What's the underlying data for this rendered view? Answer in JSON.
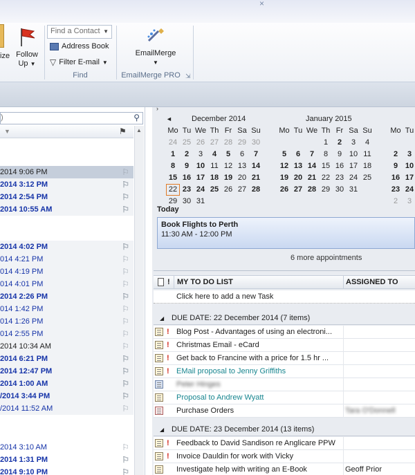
{
  "ribbon": {
    "follow_up_left_fragment": "ize",
    "follow_up_label": "Follow",
    "follow_up_label2": "Up",
    "find_contact_placeholder": "Find a Contact",
    "address_book_label": "Address Book",
    "filter_email_label": "Filter E-mail",
    "find_group_label": "Find",
    "emailmerge_label": "EmailMerge",
    "emailmerge_group_label": "EmailMerge PRO"
  },
  "mail_list": {
    "search_fragment": ")",
    "items": [
      {
        "text": "2014 9:06 PM",
        "style": "sel"
      },
      {
        "text": "2014 3:12 PM",
        "style": "bold"
      },
      {
        "text": "2014 2:54 PM",
        "style": "bold"
      },
      {
        "text": "2014 10:55 AM",
        "style": "bold"
      },
      {
        "text": "2014 4:02 PM",
        "style": "bold"
      },
      {
        "text": "014 4:21 PM",
        "style": "norm"
      },
      {
        "text": "014 4:19 PM",
        "style": "norm"
      },
      {
        "text": "014 4:01 PM",
        "style": "norm"
      },
      {
        "text": "2014 2:26 PM",
        "style": "bold"
      },
      {
        "text": "014 1:42 PM",
        "style": "norm"
      },
      {
        "text": "014 1:26 PM",
        "style": "norm"
      },
      {
        "text": "014 2:55 PM",
        "style": "norm"
      },
      {
        "text": "2014 10:34 AM",
        "style": "black"
      },
      {
        "text": "2014 6:21 PM",
        "style": "bold"
      },
      {
        "text": "2014 12:47 PM",
        "style": "bold"
      },
      {
        "text": "2014 1:00 AM",
        "style": "bold"
      },
      {
        "text": "/2014 3:44 PM",
        "style": "bold"
      },
      {
        "text": "/2014 11:52 AM",
        "style": "norm"
      },
      {
        "text": "2014 3:10 AM",
        "style": "norm"
      },
      {
        "text": "2014 1:31 PM",
        "style": "bold"
      },
      {
        "text": "2014 9:10 PM",
        "style": "bold"
      }
    ]
  },
  "calendar": {
    "prev_arrow": "◄",
    "month1_title": "December 2014",
    "month2_title": "January 2015",
    "weekdays": [
      "Mo",
      "Tu",
      "We",
      "Th",
      "Fr",
      "Sa",
      "Su"
    ],
    "today_label": "Today",
    "appointment_title": "Book Flights to Perth",
    "appointment_time": "11:30 AM - 12:00 PM",
    "more_appointments": "6 more appointments"
  },
  "todo": {
    "col_icons": "!",
    "title": "MY TO DO LIST",
    "assigned_header": "ASSIGNED TO",
    "add_placeholder": "Click here to add a new Task",
    "group1": "DUE DATE: 22 December 2014 (7 items)",
    "group2": "DUE DATE: 23 December 2014 (13 items)",
    "tasks1": [
      {
        "title": "Blog Post - Advantages of using an electroni...",
        "important": true,
        "icon": "task",
        "assigned": ""
      },
      {
        "title": "Christmas Email - eCard",
        "important": true,
        "icon": "task",
        "assigned": ""
      },
      {
        "title": "Get back to Francine with a price for 1.5 hr ...",
        "important": true,
        "icon": "task",
        "assigned": ""
      },
      {
        "title": "EMail proposal to Jenny Griffiths",
        "important": true,
        "icon": "task",
        "assigned": "",
        "teal": true
      },
      {
        "title": "Peter Hinges",
        "important": false,
        "icon": "contact",
        "assigned": "",
        "blur": true
      },
      {
        "title": "Proposal to Andrew Wyatt",
        "important": false,
        "icon": "task",
        "assigned": "",
        "teal": true
      },
      {
        "title": "Purchase Orders",
        "important": false,
        "icon": "env",
        "assigned": "Tara O'Donnell"
      }
    ],
    "tasks2": [
      {
        "title": "Feedback to David Sandison re Anglicare PPW",
        "important": true,
        "icon": "task",
        "assigned": ""
      },
      {
        "title": "Invoice Dauldin for work with Vicky",
        "important": true,
        "icon": "task",
        "assigned": ""
      },
      {
        "title": "Investigate help with writing an E-Book",
        "important": false,
        "icon": "task",
        "assigned": "Geoff Prior"
      }
    ]
  }
}
